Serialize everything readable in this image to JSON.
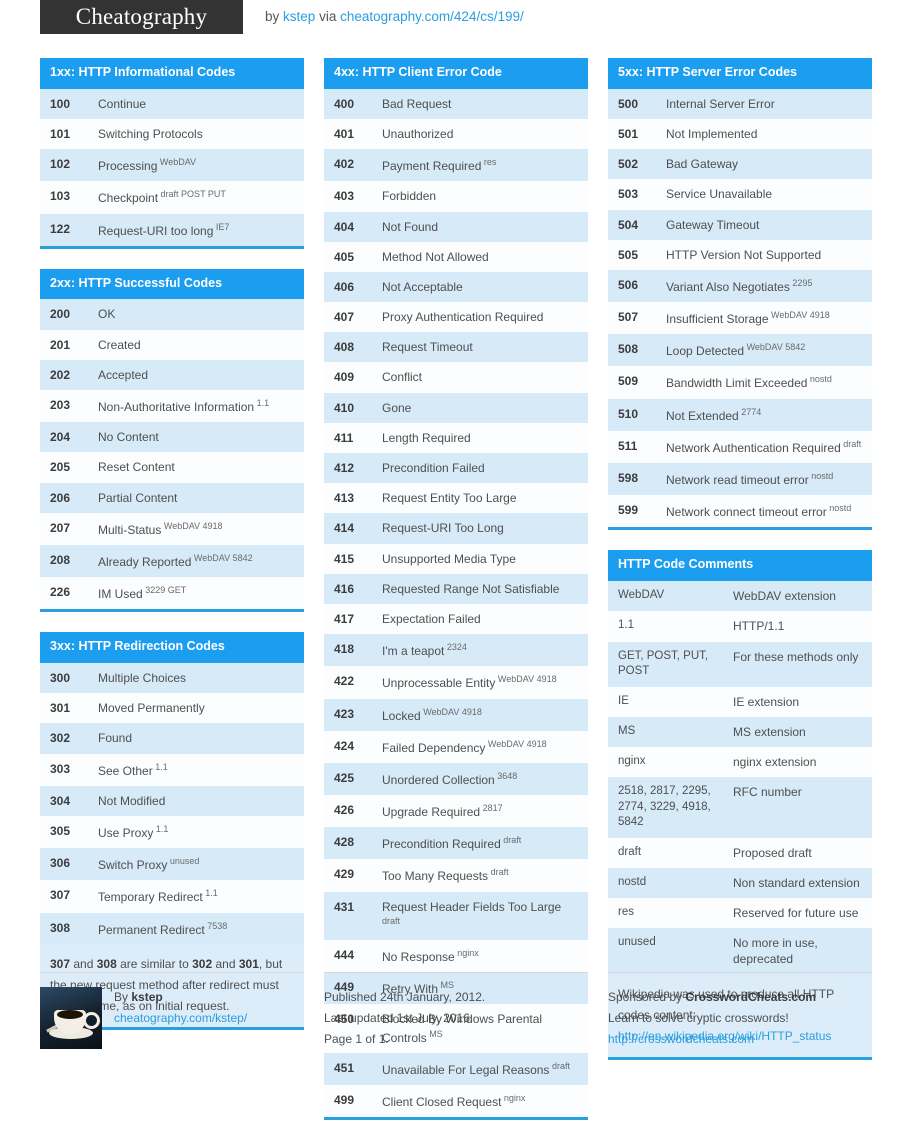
{
  "masthead": {
    "logo": "Cheatography",
    "by_prefix": "by",
    "author": "kstep",
    "via": "via",
    "url": "cheatography.com/424/cs/199/"
  },
  "colors": {
    "header_blue": "#1b9df0",
    "accent_blue": "#2a9fe0",
    "row_stripe": "#d7eaf8",
    "row_plain": "#fbfdfe",
    "note_bg": "#dcecf8",
    "logo_bg": "#333333"
  },
  "sections": [
    {
      "id": "1xx",
      "title": "1xx: HTTP Informational Codes",
      "rows": [
        {
          "code": "100",
          "desc": "Continue",
          "sup": ""
        },
        {
          "code": "101",
          "desc": "Switching Protocols",
          "sup": ""
        },
        {
          "code": "102",
          "desc": "Processing",
          "sup": "WebDAV"
        },
        {
          "code": "103",
          "desc": "Checkpoint",
          "sup": "draft POST PUT"
        },
        {
          "code": "122",
          "desc": "Request-URI too long",
          "sup": "IE7"
        }
      ]
    },
    {
      "id": "2xx",
      "title": "2xx: HTTP Successful Codes",
      "rows": [
        {
          "code": "200",
          "desc": "OK",
          "sup": ""
        },
        {
          "code": "201",
          "desc": "Created",
          "sup": ""
        },
        {
          "code": "202",
          "desc": "Accepted",
          "sup": ""
        },
        {
          "code": "203",
          "desc": "Non-Authoritative Information",
          "sup": "1.1"
        },
        {
          "code": "204",
          "desc": "No Content",
          "sup": ""
        },
        {
          "code": "205",
          "desc": "Reset Content",
          "sup": ""
        },
        {
          "code": "206",
          "desc": "Partial Content",
          "sup": ""
        },
        {
          "code": "207",
          "desc": "Multi-Status",
          "sup": "WebDAV 4918"
        },
        {
          "code": "208",
          "desc": "Already Reported",
          "sup": "WebDAV 5842"
        },
        {
          "code": "226",
          "desc": "IM Used",
          "sup": "3229 GET"
        }
      ]
    },
    {
      "id": "3xx",
      "title": "3xx: HTTP Redirection Codes",
      "rows": [
        {
          "code": "300",
          "desc": "Multiple Choices",
          "sup": ""
        },
        {
          "code": "301",
          "desc": "Moved Permanently",
          "sup": ""
        },
        {
          "code": "302",
          "desc": "Found",
          "sup": ""
        },
        {
          "code": "303",
          "desc": "See Other",
          "sup": "1.1"
        },
        {
          "code": "304",
          "desc": "Not Modified",
          "sup": ""
        },
        {
          "code": "305",
          "desc": "Use Proxy",
          "sup": "1.1"
        },
        {
          "code": "306",
          "desc": "Switch Proxy",
          "sup": "unused"
        },
        {
          "code": "307",
          "desc": "Temporary Redirect",
          "sup": "1.1"
        },
        {
          "code": "308",
          "desc": "Permanent Redirect",
          "sup": "7538"
        }
      ],
      "note_html": "<b>307</b> and <b>308</b> are similar to <b>302</b> and <b>301</b>, but the new request method after redirect must be the same, as on initial request."
    },
    {
      "id": "4xx",
      "title": "4xx: HTTP Client Error Code",
      "rows": [
        {
          "code": "400",
          "desc": "Bad Request",
          "sup": ""
        },
        {
          "code": "401",
          "desc": "Unauthorized",
          "sup": ""
        },
        {
          "code": "402",
          "desc": "Payment Required",
          "sup": "res"
        },
        {
          "code": "403",
          "desc": "Forbidden",
          "sup": ""
        },
        {
          "code": "404",
          "desc": "Not Found",
          "sup": ""
        },
        {
          "code": "405",
          "desc": "Method Not Allowed",
          "sup": ""
        },
        {
          "code": "406",
          "desc": "Not Acceptable",
          "sup": ""
        },
        {
          "code": "407",
          "desc": "Proxy Authentication Required",
          "sup": ""
        },
        {
          "code": "408",
          "desc": "Request Timeout",
          "sup": ""
        },
        {
          "code": "409",
          "desc": "Conflict",
          "sup": ""
        },
        {
          "code": "410",
          "desc": "Gone",
          "sup": ""
        },
        {
          "code": "411",
          "desc": "Length Required",
          "sup": ""
        },
        {
          "code": "412",
          "desc": "Precondition Failed",
          "sup": ""
        },
        {
          "code": "413",
          "desc": "Request Entity Too Large",
          "sup": ""
        },
        {
          "code": "414",
          "desc": "Request-URI Too Long",
          "sup": ""
        },
        {
          "code": "415",
          "desc": "Unsupported Media Type",
          "sup": ""
        },
        {
          "code": "416",
          "desc": "Requested Range Not Satisfiable",
          "sup": ""
        },
        {
          "code": "417",
          "desc": "Expectation Failed",
          "sup": ""
        },
        {
          "code": "418",
          "desc": "I'm a teapot",
          "sup": "2324"
        },
        {
          "code": "422",
          "desc": "Unprocessable Entity",
          "sup": "WebDAV 4918"
        },
        {
          "code": "423",
          "desc": "Locked",
          "sup": "WebDAV 4918"
        },
        {
          "code": "424",
          "desc": "Failed Dependency",
          "sup": "WebDAV 4918"
        },
        {
          "code": "425",
          "desc": "Unordered Collection",
          "sup": "3648"
        },
        {
          "code": "426",
          "desc": "Upgrade Required",
          "sup": "2817"
        },
        {
          "code": "428",
          "desc": "Precondition Required",
          "sup": "draft"
        },
        {
          "code": "429",
          "desc": "Too Many Requests",
          "sup": "draft"
        },
        {
          "code": "431",
          "desc": "Request Header Fields Too Large",
          "sup": "draft"
        },
        {
          "code": "444",
          "desc": "No Response",
          "sup": "nginx"
        },
        {
          "code": "449",
          "desc": "Retry With",
          "sup": "MS"
        },
        {
          "code": "450",
          "desc": "Blocked By Windows Parental Controls",
          "sup": "MS"
        },
        {
          "code": "451",
          "desc": "Unavailable For Legal Reasons",
          "sup": "draft"
        },
        {
          "code": "499",
          "desc": "Client Closed Request",
          "sup": "nginx"
        }
      ]
    },
    {
      "id": "5xx",
      "title": "5xx: HTTP Server Error Codes",
      "rows": [
        {
          "code": "500",
          "desc": "Internal Server Error",
          "sup": ""
        },
        {
          "code": "501",
          "desc": "Not Implemented",
          "sup": ""
        },
        {
          "code": "502",
          "desc": "Bad Gateway",
          "sup": ""
        },
        {
          "code": "503",
          "desc": "Service Unavailable",
          "sup": ""
        },
        {
          "code": "504",
          "desc": "Gateway Timeout",
          "sup": ""
        },
        {
          "code": "505",
          "desc": "HTTP Version Not Supported",
          "sup": ""
        },
        {
          "code": "506",
          "desc": "Variant Also Negotiates",
          "sup": "2295"
        },
        {
          "code": "507",
          "desc": "Insufficient Storage",
          "sup": "WebDAV 4918"
        },
        {
          "code": "508",
          "desc": "Loop Detected",
          "sup": "WebDAV 5842"
        },
        {
          "code": "509",
          "desc": "Bandwidth Limit Exceeded",
          "sup": "nostd"
        },
        {
          "code": "510",
          "desc": "Not Extended",
          "sup": "2774"
        },
        {
          "code": "511",
          "desc": "Network Authentication Required",
          "sup": "draft"
        },
        {
          "code": "598",
          "desc": "Network read timeout error",
          "sup": "nostd"
        },
        {
          "code": "599",
          "desc": "Network connect timeout error",
          "sup": "nostd"
        }
      ]
    }
  ],
  "comments": {
    "title": "HTTP Code Comments",
    "rows": [
      {
        "key": "WebDAV",
        "value": "WebDAV extension"
      },
      {
        "key": "1.1",
        "value": "HTTP/1.1"
      },
      {
        "key": "GET, POST, PUT, POST",
        "value": "For these methods only"
      },
      {
        "key": "IE",
        "value": "IE extension"
      },
      {
        "key": "MS",
        "value": "MS extension"
      },
      {
        "key": "nginx",
        "value": "nginx extension"
      },
      {
        "key": "2518, 2817, 2295, 2774, 3229, 4918, 5842",
        "value": "RFC number"
      },
      {
        "key": "draft",
        "value": "Proposed draft"
      },
      {
        "key": "nostd",
        "value": "Non standard extension"
      },
      {
        "key": "res",
        "value": "Reserved for future use"
      },
      {
        "key": "unused",
        "value": "No more in use, deprecated"
      }
    ],
    "source_text": "Wikipedia was used to produce all HTTP codes content:",
    "source_link": "http://en.wikipedia.org/wiki/HTTP_status"
  },
  "footer": {
    "author_prefix": "By",
    "author_name": "kstep",
    "author_url": "cheatography.com/kstep/",
    "published": "Published 24th January, 2012.",
    "updated": "Last updated 1st July, 2016.",
    "page": "Page 1 of 1.",
    "sponsor_prefix": "Sponsored by",
    "sponsor_name": "CrosswordCheats.com",
    "sponsor_tagline": "Learn to solve cryptic crosswords!",
    "sponsor_url": "http://crosswordcheats.com"
  }
}
